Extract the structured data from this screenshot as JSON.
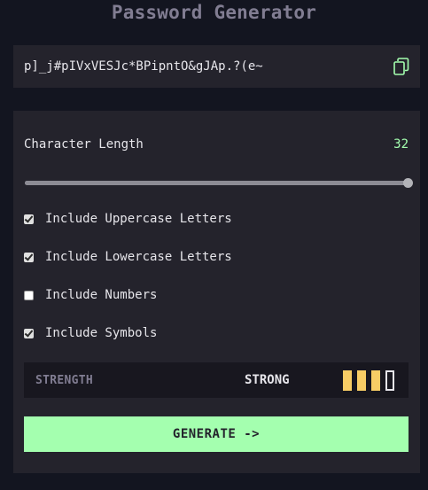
{
  "app": {
    "title": "Password Generator"
  },
  "output": {
    "password": "p]_j#pIVxVESJc*BPipntO&gJAp.?(e~",
    "copy_icon": "copy-icon"
  },
  "length": {
    "label": "Character Length",
    "value": "32",
    "slider_fraction": 1.0
  },
  "options": [
    {
      "label": "Include Uppercase Letters",
      "checked": true
    },
    {
      "label": "Include Lowercase Letters",
      "checked": true
    },
    {
      "label": "Include Numbers",
      "checked": false
    },
    {
      "label": "Include Symbols",
      "checked": true
    }
  ],
  "strength": {
    "label": "STRENGTH",
    "value": "STRONG",
    "bars_filled": 3,
    "bars_total": 4
  },
  "generate": {
    "label": "GENERATE ->"
  },
  "colors": {
    "accent": "#a4ffaf",
    "strength_fill": "#f8cd65",
    "panel": "#24232c",
    "background": "#131520"
  }
}
